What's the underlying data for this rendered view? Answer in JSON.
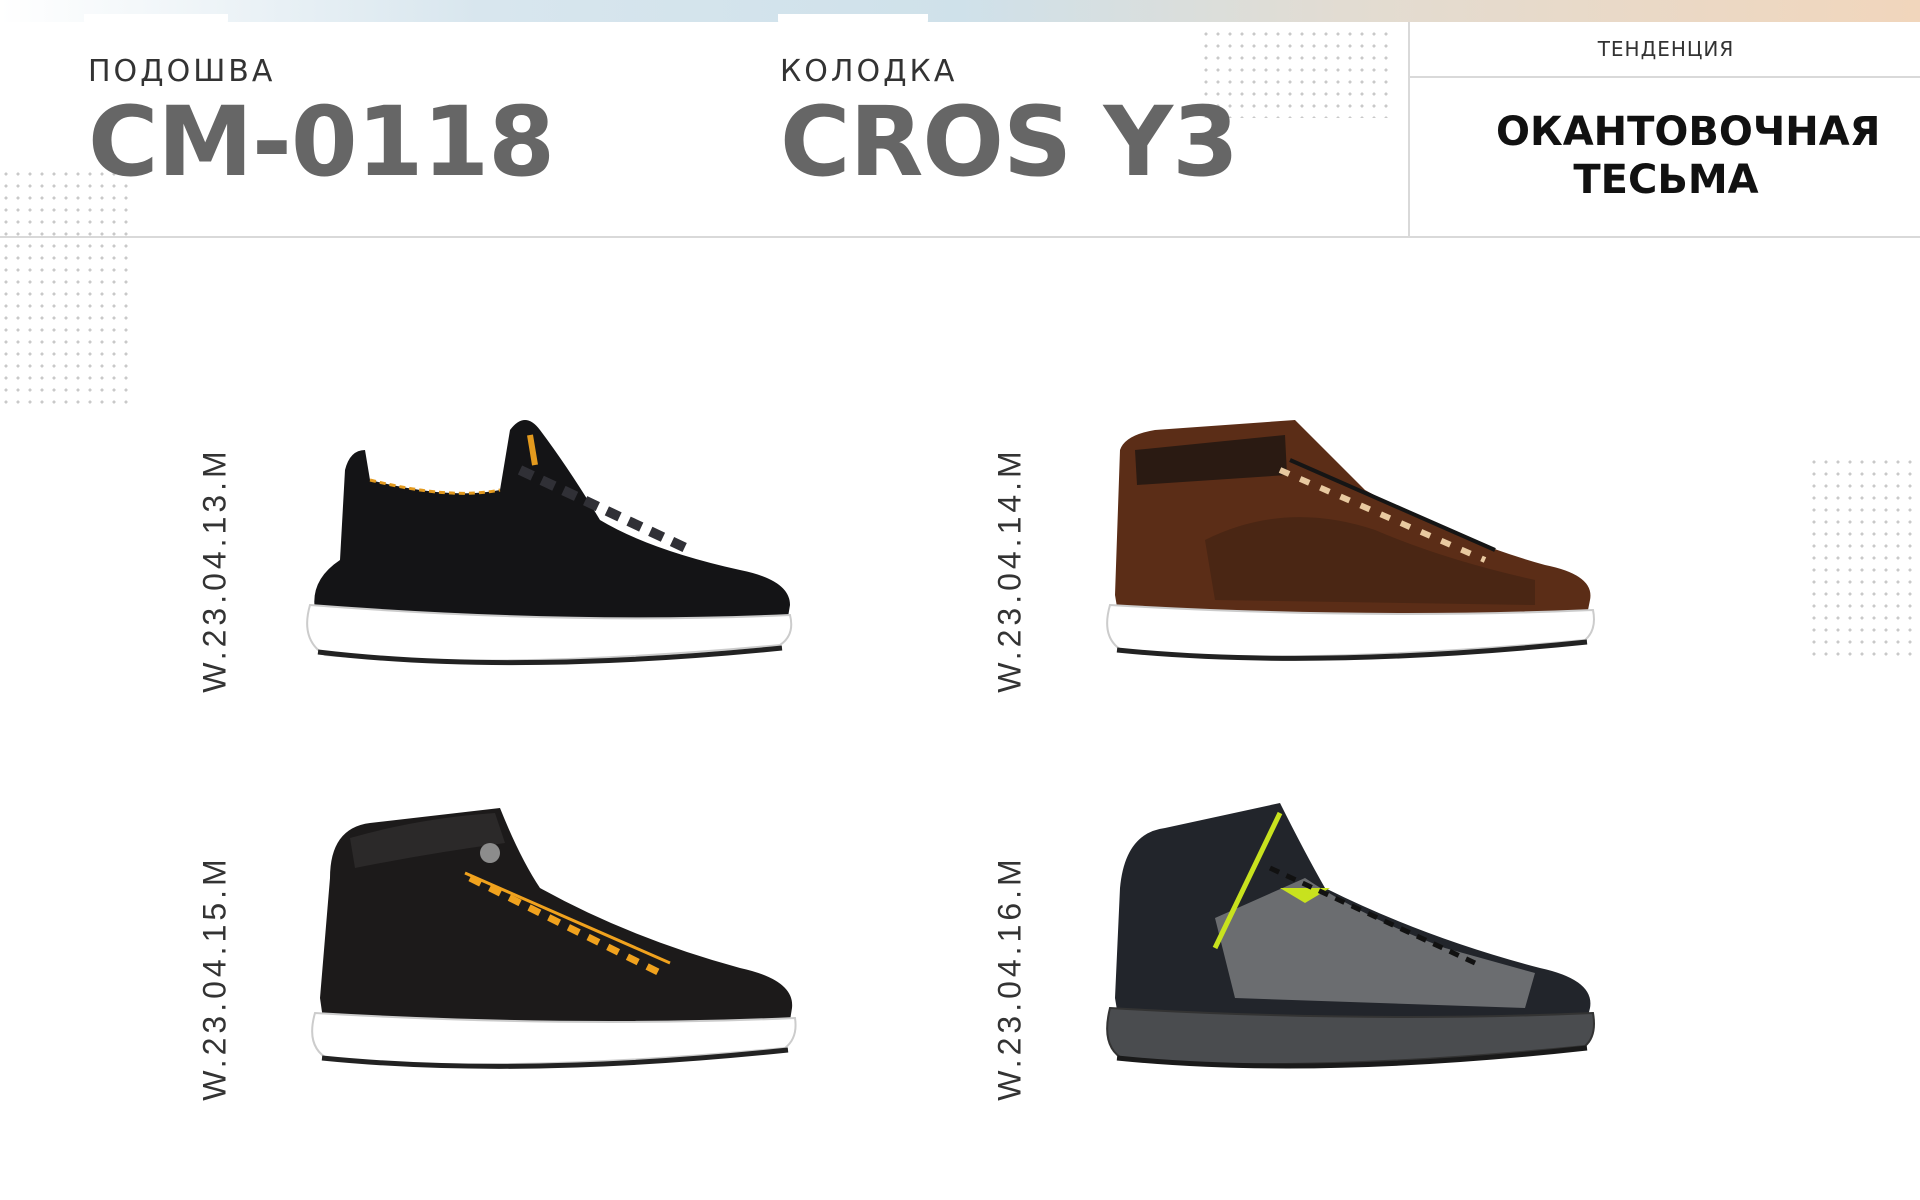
{
  "header": {
    "sole": {
      "label": "ПОДОШВА",
      "value": "СМ-0118"
    },
    "last": {
      "label": "КОЛОДКА",
      "value": "CROS Y3"
    },
    "trend": {
      "label": "ТЕНДЕНЦИЯ",
      "value": "ОКАНТОВОЧНАЯ ТЕСЬМА"
    }
  },
  "products": [
    {
      "code": "W.23.04.13.M",
      "picture": "black-textile-sneaker",
      "accent": "#e39a1e"
    },
    {
      "code": "W.23.04.14.M",
      "picture": "brown-suede-sneaker",
      "accent": "#e8c9a0"
    },
    {
      "code": "W.23.04.15.M",
      "picture": "black-leather-high-top",
      "accent": "#f0a21e"
    },
    {
      "code": "W.23.04.16.M",
      "picture": "grey-black-high-top",
      "accent": "#c8e21e"
    }
  ]
}
